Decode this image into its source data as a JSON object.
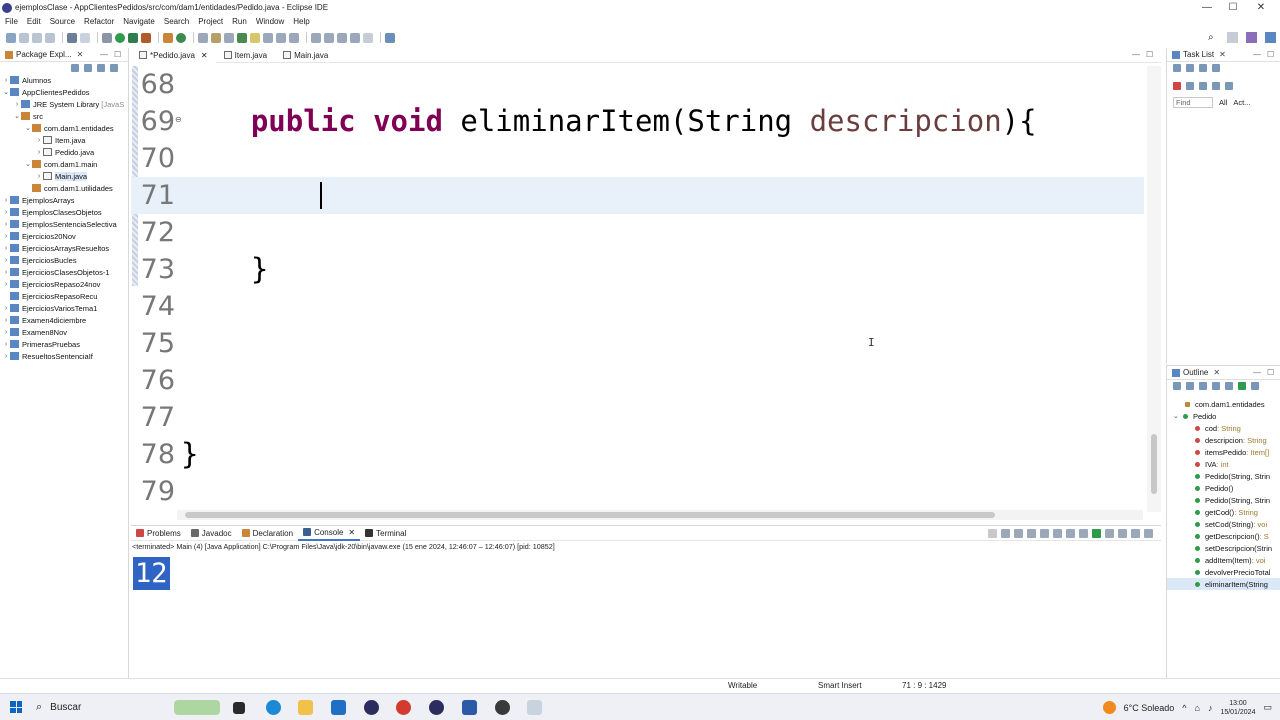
{
  "window": {
    "title": "ejemplosClase - AppClientesPedidos/src/com/dam1/entidades/Pedido.java - Eclipse IDE",
    "controls": [
      "—",
      "☐",
      "✕"
    ]
  },
  "menu": [
    "File",
    "Edit",
    "Source",
    "Refactor",
    "Navigate",
    "Search",
    "Project",
    "Run",
    "Window",
    "Help"
  ],
  "package_explorer": {
    "tab_label": "Package Expl...",
    "close": "✕",
    "tree": [
      {
        "label": "Alumnos",
        "chev": "›",
        "indent": 0
      },
      {
        "label": "AppClientesPedidos",
        "chev": "⌄",
        "indent": 0
      },
      {
        "label": "JRE System Library",
        "extra": "[JavaS",
        "chev": "›",
        "indent": 1
      },
      {
        "label": "src",
        "chev": "⌄",
        "indent": 1
      },
      {
        "label": "com.dam1.entidades",
        "chev": "⌄",
        "indent": 2
      },
      {
        "label": "Item.java",
        "chev": "›",
        "indent": 3
      },
      {
        "label": "Pedido.java",
        "chev": "›",
        "indent": 3
      },
      {
        "label": "com.dam1.main",
        "chev": "⌄",
        "indent": 2
      },
      {
        "label": "Main.java",
        "chev": "›",
        "indent": 3,
        "selected": true
      },
      {
        "label": "com.dam1.utilidades",
        "chev": "",
        "indent": 2
      },
      {
        "label": "EjemplosArrays",
        "chev": "›",
        "indent": 0
      },
      {
        "label": "EjemplosClasesObjetos",
        "chev": "›",
        "indent": 0
      },
      {
        "label": "EjemplosSentenciaSelectiva",
        "chev": "›",
        "indent": 0
      },
      {
        "label": "Ejercicios20Nov",
        "chev": "›",
        "indent": 0
      },
      {
        "label": "EjerciciosArraysResueltos",
        "chev": "›",
        "indent": 0
      },
      {
        "label": "EjerciciosBucles",
        "chev": "›",
        "indent": 0
      },
      {
        "label": "EjerciciosClasesObjetos-1",
        "chev": "›",
        "indent": 0
      },
      {
        "label": "EjerciciosRepaso24nov",
        "chev": "›",
        "indent": 0
      },
      {
        "label": "EjerciciosRepasoRecu",
        "chev": "",
        "indent": 0
      },
      {
        "label": "EjerciciosVariosTema1",
        "chev": "›",
        "indent": 0
      },
      {
        "label": "Examen4diciembre",
        "chev": "›",
        "indent": 0
      },
      {
        "label": "Examen8Nov",
        "chev": "›",
        "indent": 0
      },
      {
        "label": "PrimerasPruebas",
        "chev": "›",
        "indent": 0
      },
      {
        "label": "ResueltosSentenciaIf",
        "chev": "›",
        "indent": 0
      }
    ]
  },
  "editor": {
    "tabs": [
      {
        "label": "*Pedido.java",
        "active": true,
        "close": "✕"
      },
      {
        "label": "Item.java",
        "active": false
      },
      {
        "label": "Main.java",
        "active": false
      }
    ],
    "lines": [
      {
        "num": "68",
        "code": ""
      },
      {
        "num": "69",
        "code": "    public void eliminarItem(String descripcion){",
        "fold": "⊖"
      },
      {
        "num": "70",
        "code": ""
      },
      {
        "num": "71",
        "code": "",
        "current": true
      },
      {
        "num": "72",
        "code": ""
      },
      {
        "num": "73",
        "code": "    }"
      },
      {
        "num": "74",
        "code": ""
      },
      {
        "num": "75",
        "code": ""
      },
      {
        "num": "76",
        "code": ""
      },
      {
        "num": "77",
        "code": ""
      },
      {
        "num": "78",
        "code": "}"
      },
      {
        "num": "79",
        "code": ""
      }
    ],
    "keywords": {
      "k1": "public",
      "k2": "void"
    },
    "method_prefix": "eliminarItem(String ",
    "param": "descripcion",
    "suffix": "){",
    "closing_brace_inner": "}",
    "closing_brace_outer": "}"
  },
  "console": {
    "tabs": [
      {
        "label": "Problems",
        "active": false
      },
      {
        "label": "Javadoc",
        "active": false
      },
      {
        "label": "Declaration",
        "active": false
      },
      {
        "label": "Console",
        "active": true,
        "close": "✕"
      },
      {
        "label": "Terminal",
        "active": false
      }
    ],
    "status": "<terminated> Main (4) [Java Application] C:\\Program Files\\Java\\jdk-20\\bin\\javaw.exe  (15 ene 2024, 12:46:07 – 12:46:07) [pid: 10852]",
    "output": "12"
  },
  "task_list": {
    "tab_label": "Task List",
    "close": "✕",
    "find_placeholder": "Find",
    "all": "All",
    "activate": "Act..."
  },
  "outline": {
    "tab_label": "Outline",
    "close": "✕",
    "package": "com.dam1.entidades",
    "class": "Pedido",
    "members": [
      {
        "name": "cod",
        "type": " : String",
        "color": "#d04646"
      },
      {
        "name": "descripcion",
        "type": " : String",
        "color": "#d04646"
      },
      {
        "name": "itemsPedido",
        "type": " : Item[]",
        "color": "#d04646"
      },
      {
        "name": "IVA",
        "type": " : int",
        "color": "#d04646"
      },
      {
        "name": "Pedido(String, Strin",
        "type": "",
        "color": "#2e9b4a"
      },
      {
        "name": "Pedido()",
        "type": "",
        "color": "#2e9b4a"
      },
      {
        "name": "Pedido(String, Strin",
        "type": "",
        "color": "#2e9b4a"
      },
      {
        "name": "getCod()",
        "type": " : String",
        "color": "#2e9b4a"
      },
      {
        "name": "setCod(String)",
        "type": " : voi",
        "color": "#2e9b4a"
      },
      {
        "name": "getDescripcion()",
        "type": " : S",
        "color": "#2e9b4a"
      },
      {
        "name": "setDescripcion(Strin",
        "type": "",
        "color": "#2e9b4a"
      },
      {
        "name": "addItem(Item)",
        "type": " : voi",
        "color": "#2e9b4a"
      },
      {
        "name": "devolverPrecioTotal",
        "type": "",
        "color": "#2e9b4a"
      },
      {
        "name": "eliminarItem(String",
        "type": "",
        "color": "#2e9b4a",
        "selected": true
      }
    ]
  },
  "statusbar": {
    "writable": "Writable",
    "insert_mode": "Smart Insert",
    "position": "71 : 9 : 1429"
  },
  "taskbar": {
    "search_label": "Buscar",
    "weather": "6°C  Soleado",
    "time": "13:00",
    "date": "15/01/2024",
    "tray_arrow": "^"
  },
  "colors": {
    "keyword": "#7f0055",
    "param": "#6a3e3e",
    "current_line": "#e8f0fa",
    "console_selection": "#2f64c5"
  }
}
